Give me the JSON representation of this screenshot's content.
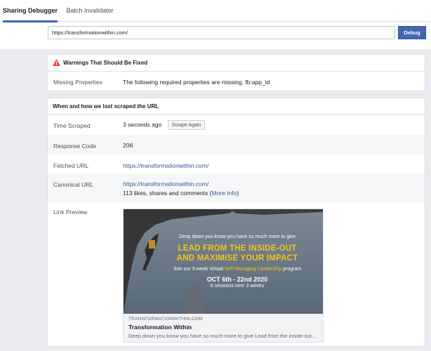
{
  "tabs": [
    {
      "label": "Sharing Debugger",
      "active": true
    },
    {
      "label": "Batch Invalidator",
      "active": false
    }
  ],
  "search": {
    "value": "https://transformationwithin.com/",
    "button_label": "Debug"
  },
  "warnings": {
    "title": "Warnings That Should Be Fixed",
    "rows": [
      {
        "label": "Missing Properties",
        "value": "The following required properties are missing: fb:app_id"
      }
    ]
  },
  "scrape": {
    "title": "When and how we last scraped the URL",
    "time_scraped": {
      "label": "Time Scraped",
      "value": "3 seconds ago",
      "button_label": "Scrape Again"
    },
    "response_code": {
      "label": "Response Code",
      "value": "206"
    },
    "fetched_url": {
      "label": "Fetched URL",
      "value": "https://transformationwithin.com/"
    },
    "canonical_url": {
      "label": "Canonical URL",
      "value": "https://transformationwithin.com/",
      "stats_prefix": "113 likes, shares and comments (",
      "more_info": "More Info",
      "stats_suffix": ")"
    },
    "link_preview": {
      "label": "Link Preview",
      "image_text": {
        "line1": "Deep down you know you have so much more to give",
        "headline1": "LEAD FROM THE INSIDE-OUT",
        "headline2": "AND MAXIMISE YOUR IMPACT",
        "line3_prefix": "Join our 3-week Virtual ",
        "line3_highlight": "Self Managing Leadership",
        "line3_suffix": " program",
        "date": "OCT 6th - 22nd 2020",
        "sessions": "6 sessions over 3 weeks"
      },
      "domain": "TRANSFORMATIONWITHIN.COM",
      "title": "Transformation Within",
      "description": "Deep down you know you have so much more to give Lead from the inside-out and maximise your impact"
    }
  },
  "colors": {
    "accent": "#4267b2",
    "warning": "#fa3e3e",
    "highlight": "#f6c21c",
    "link": "#385898"
  }
}
